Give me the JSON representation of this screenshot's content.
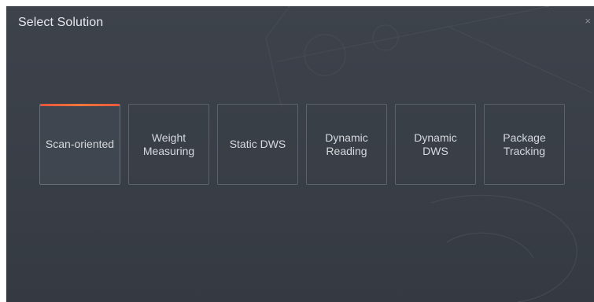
{
  "dialog": {
    "title": "Select Solution",
    "close_glyph": "×"
  },
  "colors": {
    "background": "#3a3f48",
    "tile_border": "#5c626c",
    "active_accent": "#f0763a",
    "text": "#d6d9de"
  },
  "solutions": [
    {
      "label": "Scan-oriented",
      "active": true
    },
    {
      "label": "Weight\nMeasuring",
      "active": false
    },
    {
      "label": "Static DWS",
      "active": false
    },
    {
      "label": "Dynamic\nReading",
      "active": false
    },
    {
      "label": "Dynamic\nDWS",
      "active": false
    },
    {
      "label": "Package\nTracking",
      "active": false
    }
  ]
}
